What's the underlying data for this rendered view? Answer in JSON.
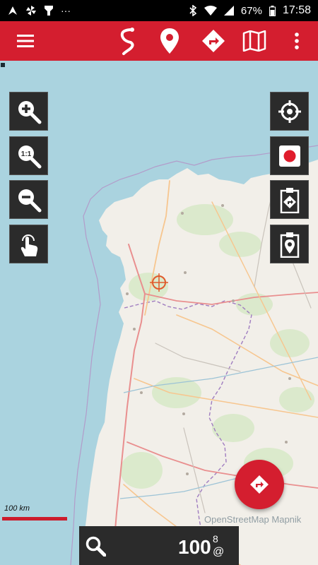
{
  "status_bar": {
    "left_icons": [
      "navigation-icon",
      "pinwheel-icon",
      "flashlight-icon",
      "more-dots-icon"
    ],
    "more_dots": "···",
    "battery": "67%",
    "time": "17:58"
  },
  "app_bar": {
    "color": "#d41e2f",
    "actions": [
      "menu-icon",
      "route-icon",
      "map-pin-icon",
      "directions-icon",
      "map-icon",
      "overflow-icon"
    ]
  },
  "map": {
    "scale_label": "100 km",
    "attribution": "OpenStreetMap Mapnik",
    "left_controls": [
      "zoom-in-icon",
      "zoom-reset-icon",
      "zoom-out-icon",
      "touch-icon"
    ],
    "right_controls": [
      "crosshair-icon",
      "record-icon",
      "clipboard-route-icon",
      "clipboard-pin-icon"
    ]
  },
  "bottom_panel": {
    "zoom_value": "100",
    "zoom_sup": "8",
    "zoom_sub": "@"
  }
}
